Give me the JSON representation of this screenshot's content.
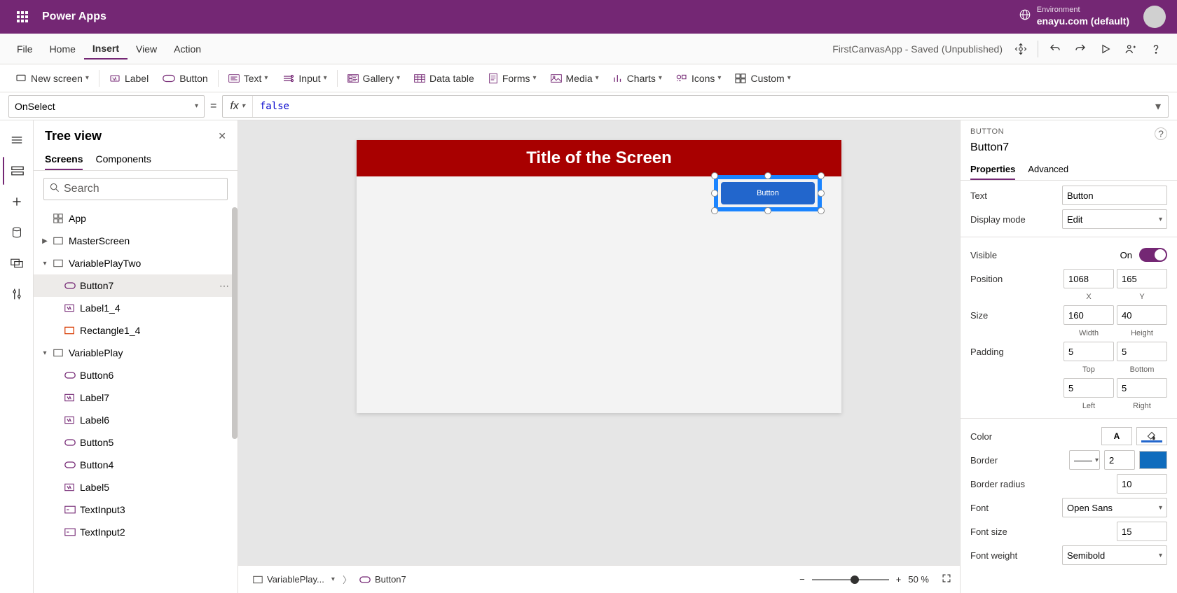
{
  "header": {
    "app_title": "Power Apps",
    "environment_label": "Environment",
    "environment_value": "enayu.com (default)"
  },
  "menubar": {
    "items": [
      "File",
      "Home",
      "Insert",
      "View",
      "Action"
    ],
    "active": "Insert",
    "status": "FirstCanvasApp - Saved (Unpublished)"
  },
  "ribbon": {
    "new_screen": "New screen",
    "label": "Label",
    "button": "Button",
    "text": "Text",
    "input": "Input",
    "gallery": "Gallery",
    "data_table": "Data table",
    "forms": "Forms",
    "media": "Media",
    "charts": "Charts",
    "icons": "Icons",
    "custom": "Custom"
  },
  "formula": {
    "property": "OnSelect",
    "fx": "fx",
    "value": "false"
  },
  "tree": {
    "title": "Tree view",
    "tabs": {
      "screens": "Screens",
      "components": "Components"
    },
    "search_placeholder": "Search",
    "nodes": {
      "app": "App",
      "master": "MasterScreen",
      "vartwo": "VariablePlayTwo",
      "button7": "Button7",
      "label1_4": "Label1_4",
      "rect1_4": "Rectangle1_4",
      "varone": "VariablePlay",
      "button6": "Button6",
      "label7": "Label7",
      "label6": "Label6",
      "button5": "Button5",
      "button4": "Button4",
      "label5": "Label5",
      "textinput3": "TextInput3",
      "textinput2": "TextInput2"
    }
  },
  "canvas": {
    "screen_title": "Title of the Screen",
    "button_text": "Button",
    "crumb_screen": "VariablePlay...",
    "crumb_control": "Button7",
    "zoom": "50 %"
  },
  "props": {
    "type_label": "BUTTON",
    "name": "Button7",
    "tabs": {
      "properties": "Properties",
      "advanced": "Advanced"
    },
    "text_label": "Text",
    "text_value": "Button",
    "display_mode_label": "Display mode",
    "display_mode_value": "Edit",
    "visible_label": "Visible",
    "visible_on": "On",
    "position_label": "Position",
    "pos_x": "1068",
    "pos_y": "165",
    "x_lbl": "X",
    "y_lbl": "Y",
    "size_label": "Size",
    "width": "160",
    "height": "40",
    "w_lbl": "Width",
    "h_lbl": "Height",
    "padding_label": "Padding",
    "pad_top": "5",
    "pad_bottom": "5",
    "pad_left": "5",
    "pad_right": "5",
    "top_lbl": "Top",
    "bottom_lbl": "Bottom",
    "left_lbl": "Left",
    "right_lbl": "Right",
    "color_label": "Color",
    "border_label": "Border",
    "border_width": "2",
    "border_radius_label": "Border radius",
    "border_radius": "10",
    "font_label": "Font",
    "font_value": "Open Sans",
    "font_size_label": "Font size",
    "font_size": "15",
    "font_weight_label": "Font weight",
    "font_weight": "Semibold",
    "border_style": "——"
  }
}
